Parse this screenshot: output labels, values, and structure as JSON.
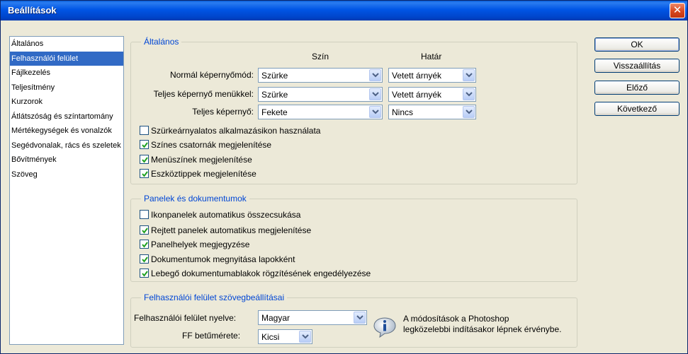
{
  "window": {
    "title": "Beállítások",
    "close_glyph": "✕"
  },
  "nav": {
    "items": [
      "Általános",
      "Felhasználói felület",
      "Fájlkezelés",
      "Teljesítmény",
      "Kurzorok",
      "Átlátszóság és színtartomány",
      "Mértékegységek és vonalzók",
      "Segédvonalak, rács és szeletek",
      "Bővítmények",
      "Szöveg"
    ],
    "selected_index": 1
  },
  "general": {
    "title": "Általános",
    "col_color": "Szín",
    "col_border": "Határ",
    "rows": [
      {
        "label": "Normál képernyőmód:",
        "color": "Szürke",
        "border": "Vetett árnyék"
      },
      {
        "label": "Teljes képernyő menükkel:",
        "color": "Szürke",
        "border": "Vetett árnyék"
      },
      {
        "label": "Teljes képernyő:",
        "color": "Fekete",
        "border": "Nincs"
      }
    ],
    "checks": [
      {
        "label": "Szürkeárnyalatos alkalmazásikon használata",
        "checked": false
      },
      {
        "label": "Színes csatornák megjelenítése",
        "checked": true
      },
      {
        "label": "Menüszínek megjelenítése",
        "checked": true
      },
      {
        "label": "Eszköztippek megjelenítése",
        "checked": true
      }
    ]
  },
  "panels": {
    "title": "Panelek és dokumentumok",
    "checks": [
      {
        "label": "Ikonpanelek automatikus összecsukása",
        "checked": false
      },
      {
        "label": "Rejtett panelek automatikus megjelenítése",
        "checked": true
      },
      {
        "label": "Panelhelyek megjegyzése",
        "checked": true
      },
      {
        "label": "Dokumentumok megnyitása lapokként",
        "checked": true
      },
      {
        "label": "Lebegő dokumentumablakok rögzítésének engedélyezése",
        "checked": true
      }
    ]
  },
  "ui_text": {
    "title": "Felhasználói felület szövegbeállításai",
    "language_label": "Felhasználói felület nyelve:",
    "language_value": "Magyar",
    "fontsize_label": "FF betűmérete:",
    "fontsize_value": "Kicsi",
    "info_line1": "A módosítások a Photoshop",
    "info_line2": "legközelebbi indításakor lépnek érvénybe."
  },
  "buttons": {
    "ok": "OK",
    "reset": "Visszaállítás",
    "prev": "Előző",
    "next": "Következő"
  },
  "colors": {
    "titlebar": "#0055e5",
    "selection": "#316ac5",
    "group_title": "#0046d5",
    "window_bg": "#ece9d8"
  }
}
